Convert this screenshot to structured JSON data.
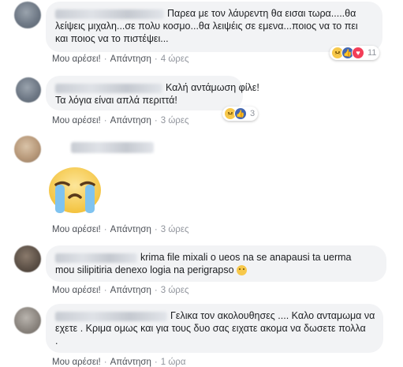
{
  "labels": {
    "like": "Μου αρέσει!",
    "reply": "Απάντηση",
    "dot": "·"
  },
  "colors": {
    "bubble": "#f2f3f5",
    "meta": "#90949c",
    "link": "#4b4f56",
    "like_blue": "#4267b2",
    "love_red": "#f33e58",
    "sad_yellow": "#f7c84b"
  },
  "comments": [
    {
      "text_lines": [
        "Παρεα με τον λάυρεντη θα εισαι τωρα.....θα",
        "λείψεις μιχαλη...σε πολυ κοσμο...θα λειψέις σε εμενα...ποιος να το πει",
        "και ποιος να το πιστέψει..."
      ],
      "time": "4 ώρες",
      "reactions": {
        "icons": [
          "sad-icon",
          "like-icon",
          "love-icon"
        ],
        "count": "11"
      }
    },
    {
      "text_lines": [
        "Καλή αντάμωση φίλε!",
        "Τα λόγια είναι απλά περιττά!"
      ],
      "time": "3 ώρες",
      "reactions": {
        "icons": [
          "sad-icon",
          "like-icon"
        ],
        "count": "3"
      }
    },
    {
      "sticker": "crying-face-sticker",
      "time": "3 ώρες"
    },
    {
      "text_lines": [
        "krima file mixali o ueos na se anapausi ta uerma",
        "mou silipitiria denexo logia na perigrapso"
      ],
      "time": "3 ώρες",
      "trailing_emoji": "sad-emoji-icon"
    },
    {
      "text_lines": [
        "Γελικα τον ακολουθησες .... Καλο ανταμωμα να",
        "εχετε . Κριμα ομως και για τους δυο σας ειχατε ακομα να δωσετε πολλα",
        "."
      ],
      "time": "1 ώρα"
    }
  ]
}
